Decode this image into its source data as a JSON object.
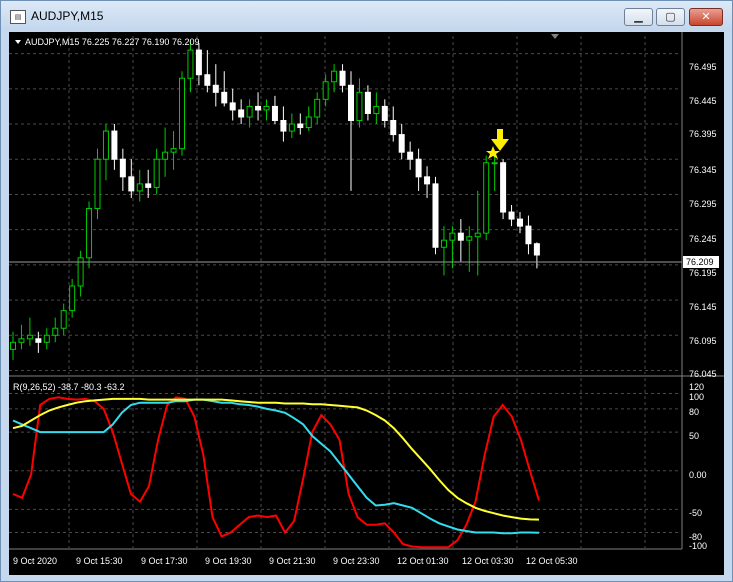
{
  "window": {
    "title": "AUDJPY,M15",
    "buttons": {
      "minimize": "▁",
      "maximize": "▢",
      "close": "✕"
    },
    "icon": "chart-window-icon"
  },
  "main_chart": {
    "header": "AUDJPY,M15  76.225 76.227 76.190 76.209",
    "current_price": "76.209",
    "price_labels": [
      "76.495",
      "76.445",
      "76.395",
      "76.345",
      "76.295",
      "76.245",
      "76.195",
      "76.145",
      "76.095",
      "76.045"
    ],
    "marker_arrow": "down-arrow-yellow",
    "marker_star": "star-yellow"
  },
  "indicator": {
    "header": "R(9,26,52) -38.7 -80.3 -63.2",
    "levels": [
      "120",
      "100",
      "80",
      "50",
      "0.00",
      "-50",
      "-80",
      "-100"
    ],
    "colors": {
      "fast": "#ff0000",
      "medium": "#33ddee",
      "slow": "#ffff33"
    }
  },
  "time_axis": [
    "9 Oct 2020",
    "9 Oct 15:30",
    "9 Oct 17:30",
    "9 Oct 19:30",
    "9 Oct 21:30",
    "9 Oct 23:30",
    "12 Oct 01:30",
    "12 Oct 03:30",
    "12 Oct 05:30"
  ],
  "colors": {
    "bull": "#00cc00",
    "bear": "#ffffff",
    "grid": "#4a4a4a",
    "background": "#000000"
  },
  "chart_data": {
    "type": "candlestick",
    "symbol": "AUDJPY",
    "timeframe": "M15",
    "ylim": [
      76.04,
      76.52
    ],
    "candles": [
      {
        "o": 76.075,
        "h": 76.1,
        "l": 76.06,
        "c": 76.085
      },
      {
        "o": 76.085,
        "h": 76.11,
        "l": 76.075,
        "c": 76.09
      },
      {
        "o": 76.09,
        "h": 76.12,
        "l": 76.08,
        "c": 76.095
      },
      {
        "o": 76.09,
        "h": 76.1,
        "l": 76.07,
        "c": 76.085
      },
      {
        "o": 76.085,
        "h": 76.105,
        "l": 76.075,
        "c": 76.095
      },
      {
        "o": 76.095,
        "h": 76.12,
        "l": 76.085,
        "c": 76.105
      },
      {
        "o": 76.105,
        "h": 76.14,
        "l": 76.095,
        "c": 76.13
      },
      {
        "o": 76.13,
        "h": 76.175,
        "l": 76.12,
        "c": 76.165
      },
      {
        "o": 76.165,
        "h": 76.215,
        "l": 76.15,
        "c": 76.205
      },
      {
        "o": 76.205,
        "h": 76.285,
        "l": 76.19,
        "c": 76.275
      },
      {
        "o": 76.275,
        "h": 76.36,
        "l": 76.26,
        "c": 76.345
      },
      {
        "o": 76.345,
        "h": 76.395,
        "l": 76.315,
        "c": 76.385
      },
      {
        "o": 76.385,
        "h": 76.395,
        "l": 76.33,
        "c": 76.345
      },
      {
        "o": 76.345,
        "h": 76.36,
        "l": 76.3,
        "c": 76.32
      },
      {
        "o": 76.32,
        "h": 76.345,
        "l": 76.29,
        "c": 76.3
      },
      {
        "o": 76.3,
        "h": 76.33,
        "l": 76.285,
        "c": 76.31
      },
      {
        "o": 76.31,
        "h": 76.33,
        "l": 76.29,
        "c": 76.305
      },
      {
        "o": 76.305,
        "h": 76.36,
        "l": 76.295,
        "c": 76.345
      },
      {
        "o": 76.345,
        "h": 76.39,
        "l": 76.32,
        "c": 76.355
      },
      {
        "o": 76.355,
        "h": 76.385,
        "l": 76.33,
        "c": 76.36
      },
      {
        "o": 76.36,
        "h": 76.47,
        "l": 76.35,
        "c": 76.46
      },
      {
        "o": 76.46,
        "h": 76.515,
        "l": 76.44,
        "c": 76.5
      },
      {
        "o": 76.5,
        "h": 76.51,
        "l": 76.45,
        "c": 76.465
      },
      {
        "o": 76.465,
        "h": 76.5,
        "l": 76.44,
        "c": 76.45
      },
      {
        "o": 76.45,
        "h": 76.48,
        "l": 76.42,
        "c": 76.44
      },
      {
        "o": 76.44,
        "h": 76.47,
        "l": 76.42,
        "c": 76.425
      },
      {
        "o": 76.425,
        "h": 76.445,
        "l": 76.4,
        "c": 76.415
      },
      {
        "o": 76.415,
        "h": 76.43,
        "l": 76.395,
        "c": 76.405
      },
      {
        "o": 76.405,
        "h": 76.43,
        "l": 76.39,
        "c": 76.42
      },
      {
        "o": 76.42,
        "h": 76.44,
        "l": 76.4,
        "c": 76.415
      },
      {
        "o": 76.415,
        "h": 76.43,
        "l": 76.4,
        "c": 76.42
      },
      {
        "o": 76.42,
        "h": 76.435,
        "l": 76.395,
        "c": 76.4
      },
      {
        "o": 76.4,
        "h": 76.42,
        "l": 76.37,
        "c": 76.385
      },
      {
        "o": 76.385,
        "h": 76.41,
        "l": 76.375,
        "c": 76.395
      },
      {
        "o": 76.395,
        "h": 76.41,
        "l": 76.38,
        "c": 76.39
      },
      {
        "o": 76.39,
        "h": 76.42,
        "l": 76.385,
        "c": 76.405
      },
      {
        "o": 76.405,
        "h": 76.44,
        "l": 76.395,
        "c": 76.43
      },
      {
        "o": 76.43,
        "h": 76.465,
        "l": 76.42,
        "c": 76.455
      },
      {
        "o": 76.455,
        "h": 76.48,
        "l": 76.44,
        "c": 76.47
      },
      {
        "o": 76.47,
        "h": 76.48,
        "l": 76.44,
        "c": 76.45
      },
      {
        "o": 76.45,
        "h": 76.47,
        "l": 76.3,
        "c": 76.4
      },
      {
        "o": 76.4,
        "h": 76.46,
        "l": 76.39,
        "c": 76.44
      },
      {
        "o": 76.44,
        "h": 76.45,
        "l": 76.4,
        "c": 76.41
      },
      {
        "o": 76.41,
        "h": 76.44,
        "l": 76.395,
        "c": 76.42
      },
      {
        "o": 76.42,
        "h": 76.43,
        "l": 76.39,
        "c": 76.4
      },
      {
        "o": 76.4,
        "h": 76.42,
        "l": 76.37,
        "c": 76.38
      },
      {
        "o": 76.38,
        "h": 76.395,
        "l": 76.345,
        "c": 76.355
      },
      {
        "o": 76.355,
        "h": 76.37,
        "l": 76.33,
        "c": 76.345
      },
      {
        "o": 76.345,
        "h": 76.36,
        "l": 76.3,
        "c": 76.32
      },
      {
        "o": 76.32,
        "h": 76.335,
        "l": 76.29,
        "c": 76.31
      },
      {
        "o": 76.31,
        "h": 76.32,
        "l": 76.21,
        "c": 76.22
      },
      {
        "o": 76.22,
        "h": 76.25,
        "l": 76.18,
        "c": 76.23
      },
      {
        "o": 76.23,
        "h": 76.25,
        "l": 76.19,
        "c": 76.24
      },
      {
        "o": 76.24,
        "h": 76.26,
        "l": 76.2,
        "c": 76.23
      },
      {
        "o": 76.23,
        "h": 76.25,
        "l": 76.185,
        "c": 76.235
      },
      {
        "o": 76.235,
        "h": 76.3,
        "l": 76.18,
        "c": 76.24
      },
      {
        "o": 76.24,
        "h": 76.35,
        "l": 76.23,
        "c": 76.34
      },
      {
        "o": 76.34,
        "h": 76.35,
        "l": 76.3,
        "c": 76.34
      },
      {
        "o": 76.34,
        "h": 76.345,
        "l": 76.26,
        "c": 76.27
      },
      {
        "o": 76.27,
        "h": 76.28,
        "l": 76.25,
        "c": 76.26
      },
      {
        "o": 76.26,
        "h": 76.27,
        "l": 76.24,
        "c": 76.25
      },
      {
        "o": 76.25,
        "h": 76.265,
        "l": 76.21,
        "c": 76.225
      },
      {
        "o": 76.225,
        "h": 76.227,
        "l": 76.19,
        "c": 76.209
      }
    ],
    "oscillator": {
      "name": "R(9,26,52)",
      "ylim": [
        -100,
        120
      ],
      "series": [
        {
          "key": "fast",
          "values": [
            -30,
            -35,
            -5,
            85,
            93,
            95,
            93,
            92,
            93,
            90,
            80,
            50,
            10,
            -30,
            -40,
            -20,
            40,
            85,
            95,
            93,
            70,
            20,
            -60,
            -85,
            -80,
            -70,
            -60,
            -58,
            -60,
            -58,
            -80,
            -65,
            -10,
            50,
            72,
            60,
            40,
            -30,
            -60,
            -70,
            -70,
            -68,
            -80,
            -95,
            -98,
            -99,
            -99,
            -99,
            -99,
            -90,
            -70,
            -40,
            20,
            70,
            85,
            70,
            40,
            0,
            -38.7
          ]
        },
        {
          "key": "medium",
          "values": [
            65,
            60,
            55,
            50,
            50,
            50,
            50,
            50,
            50,
            50,
            50,
            60,
            75,
            85,
            88,
            88,
            88,
            88,
            90,
            90,
            92,
            92,
            90,
            88,
            88,
            86,
            85,
            83,
            80,
            78,
            75,
            68,
            60,
            45,
            35,
            25,
            10,
            -5,
            -20,
            -35,
            -45,
            -44,
            -42,
            -45,
            -48,
            -55,
            -62,
            -68,
            -72,
            -76,
            -78,
            -80,
            -80,
            -80,
            -81,
            -81,
            -80,
            -80,
            -80.3
          ]
        },
        {
          "key": "slow",
          "values": [
            55,
            58,
            65,
            72,
            78,
            82,
            85,
            88,
            90,
            91,
            92,
            93,
            93,
            93,
            93,
            92,
            92,
            92,
            92,
            92,
            92,
            92,
            92,
            92,
            91,
            90,
            89,
            88,
            88,
            88,
            87,
            87,
            87,
            86,
            86,
            85,
            84,
            83,
            82,
            78,
            72,
            65,
            55,
            42,
            28,
            15,
            2,
            -12,
            -25,
            -35,
            -42,
            -48,
            -52,
            -55,
            -58,
            -60,
            -62,
            -63,
            -63.2
          ]
        }
      ]
    }
  }
}
